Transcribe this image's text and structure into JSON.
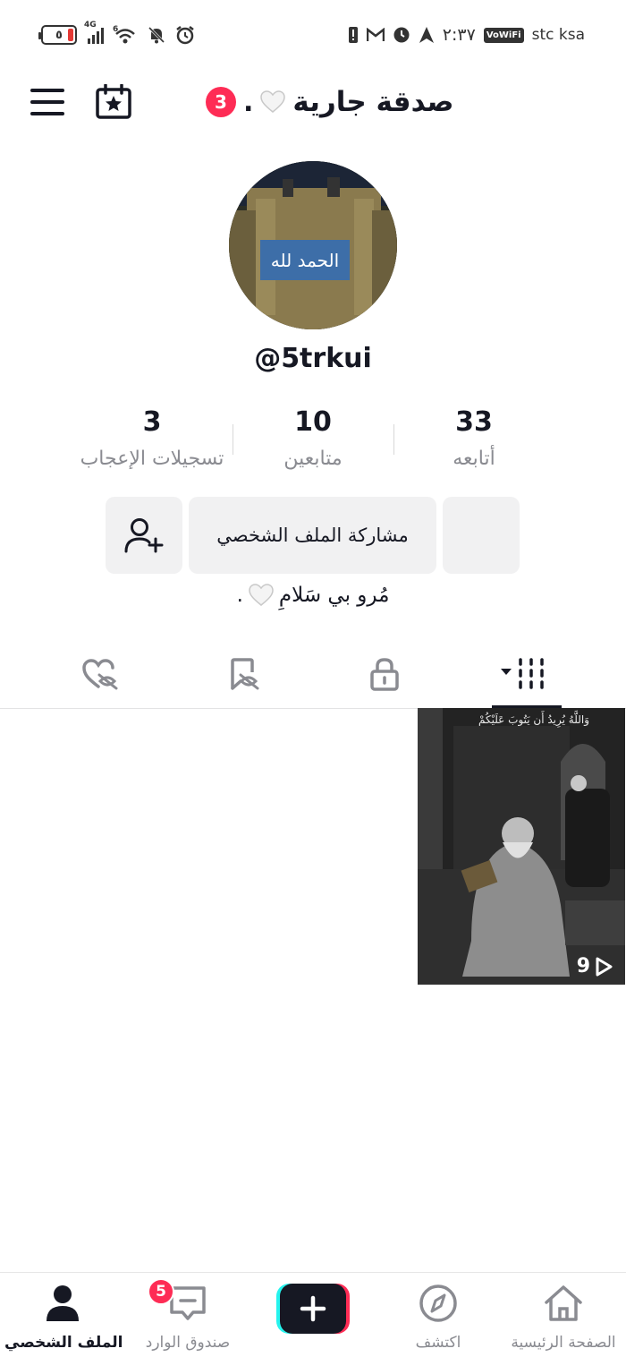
{
  "status_bar": {
    "battery": "٥",
    "network": "4G",
    "wifi_badge": "6",
    "time": "٢:٣٧",
    "vowifi": "VoWiFi",
    "carrier": "stc ksa"
  },
  "header": {
    "title": "صدقة جارية",
    "notification_count": "3"
  },
  "profile": {
    "username": "@5trkui",
    "bio": "مُرو بي سَلامِ"
  },
  "stats": [
    {
      "value": "33",
      "label": "أتابعه"
    },
    {
      "value": "10",
      "label": "متابعين"
    },
    {
      "value": "3",
      "label": "تسجيلات الإعجاب"
    }
  ],
  "actions": {
    "share_label": "مشاركة الملف الشخصي"
  },
  "tabs": [
    {
      "name": "videos",
      "icon": "grid-icon",
      "active": true
    },
    {
      "name": "private",
      "icon": "lock-icon",
      "active": false
    },
    {
      "name": "favorites",
      "icon": "bookmark-hidden-icon",
      "active": false
    },
    {
      "name": "liked",
      "icon": "heart-hidden-icon",
      "active": false
    }
  ],
  "videos": [
    {
      "caption": "وَاللَّهُ يُرِيدُ أَن يَتُوبَ عَلَيْكُمْ",
      "views": "9"
    }
  ],
  "bottom_nav": {
    "home": "الصفحة الرئيسية",
    "discover": "اكتشف",
    "inbox": "صندوق الوارد",
    "inbox_badge": "5",
    "profile": "الملف الشخصي"
  },
  "colors": {
    "accent": "#fe2c55",
    "text": "#161823",
    "muted": "#8a8b91",
    "button_bg": "#f1f1f2"
  }
}
